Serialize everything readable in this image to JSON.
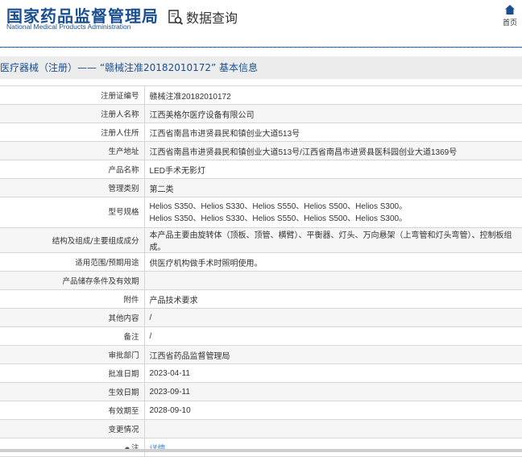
{
  "header": {
    "logo_cn": "国家药品监督管理局",
    "logo_en": "National Medical Products Administration",
    "section": "数据查询",
    "home_label": "首页"
  },
  "title": "医疗器械（注册）—— “赣械注准20182010172” 基本信息",
  "rows": [
    {
      "label": "注册证编号",
      "value": "赣械注准20182010172"
    },
    {
      "label": "注册人名称",
      "value": "江西美格尔医疗设备有限公司"
    },
    {
      "label": "注册人住所",
      "value": "江西省南昌市进贤县民和镇创业大道513号"
    },
    {
      "label": "生产地址",
      "value": "江西省南昌市进贤县民和镇创业大道513号/江西省南昌市进贤县医科园创业大道1369号"
    },
    {
      "label": "产品名称",
      "value": "LED手术无影灯"
    },
    {
      "label": "管理类别",
      "value": "第二类"
    },
    {
      "label": "型号规格",
      "value": "Helios S350、Helios S330、Helios S550、Helios S500、Helios S300。",
      "value2": "Helios S350、Helios S330、Helios S550、Helios S500、Helios S300。"
    },
    {
      "label": "结构及组成/主要组成成分",
      "value": "本产品主要由旋转体（顶板、顶管、横臂）、平衡器、灯头、万向悬架（上弯管和灯头弯管）、控制板组成。"
    },
    {
      "label": "适用范围/预期用途",
      "value": "供医疗机构做手术时照明使用。"
    },
    {
      "label": "产品储存条件及有效期",
      "value": ""
    },
    {
      "label": "附件",
      "value": "产品技术要求"
    },
    {
      "label": "其他内容",
      "value": "/"
    },
    {
      "label": "备注",
      "value": "/"
    },
    {
      "label": "审批部门",
      "value": "江西省药品监督管理局"
    },
    {
      "label": "批准日期",
      "value": "2023-04-11"
    },
    {
      "label": "生效日期",
      "value": "2023-09-11"
    },
    {
      "label": "有效期至",
      "value": "2028-09-10"
    },
    {
      "label": "变更情况",
      "value": ""
    },
    {
      "label": "注",
      "value": "详情"
    }
  ]
}
